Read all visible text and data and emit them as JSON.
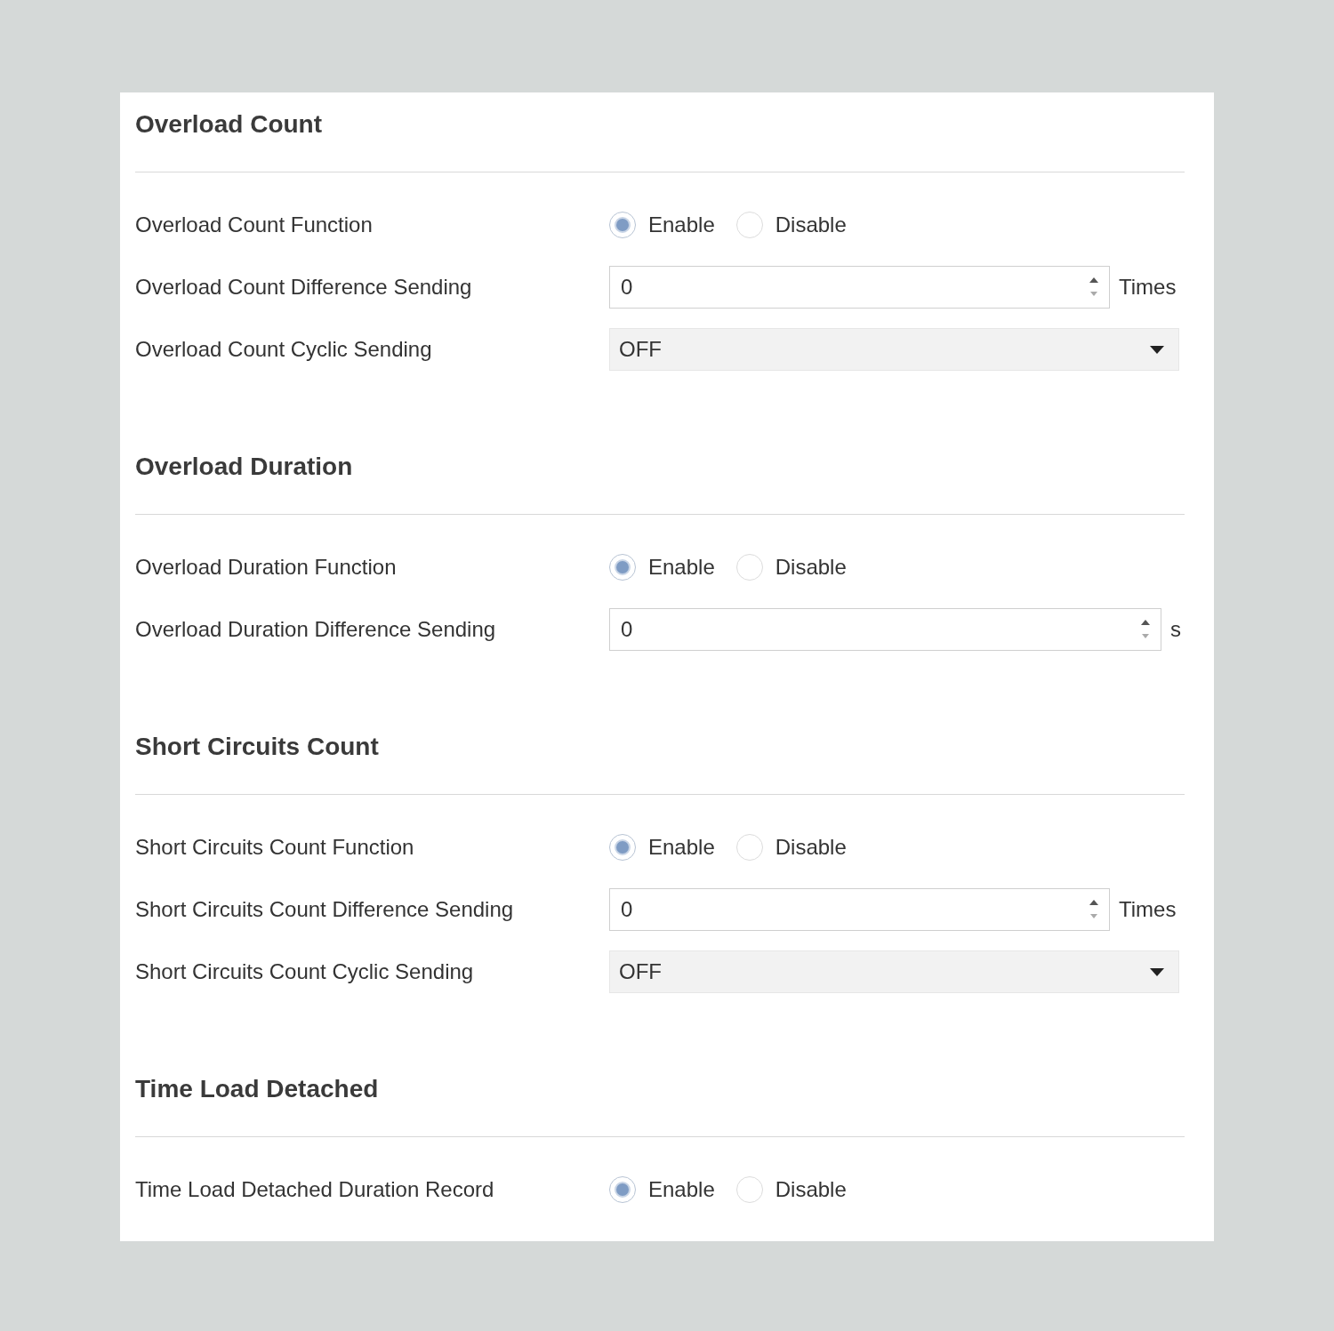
{
  "sections": [
    {
      "title": "Overload Count",
      "rows": [
        {
          "kind": "radio",
          "label": "Overload Count Function",
          "options": [
            {
              "label": "Enable",
              "selected": true
            },
            {
              "label": "Disable",
              "selected": false
            }
          ]
        },
        {
          "kind": "spin",
          "label": "Overload Count Difference Sending",
          "value": "0",
          "unit": "Times"
        },
        {
          "kind": "select",
          "label": "Overload Count Cyclic Sending",
          "value": "OFF"
        }
      ]
    },
    {
      "title": "Overload Duration",
      "rows": [
        {
          "kind": "radio",
          "label": "Overload Duration Function",
          "options": [
            {
              "label": "Enable",
              "selected": true
            },
            {
              "label": "Disable",
              "selected": false
            }
          ]
        },
        {
          "kind": "spin",
          "label": "Overload Duration Difference Sending",
          "value": "0",
          "unit": "s"
        }
      ]
    },
    {
      "title": "Short Circuits Count",
      "rows": [
        {
          "kind": "radio",
          "label": "Short Circuits Count Function",
          "options": [
            {
              "label": "Enable",
              "selected": true
            },
            {
              "label": "Disable",
              "selected": false
            }
          ]
        },
        {
          "kind": "spin",
          "label": "Short Circuits Count Difference Sending",
          "value": "0",
          "unit": "Times"
        },
        {
          "kind": "select",
          "label": "Short Circuits Count Cyclic Sending",
          "value": "OFF"
        }
      ]
    },
    {
      "title": "Time Load Detached",
      "rows": [
        {
          "kind": "radio",
          "label": "Time Load Detached Duration Record",
          "options": [
            {
              "label": "Enable",
              "selected": true
            },
            {
              "label": "Disable",
              "selected": false
            }
          ]
        }
      ]
    }
  ]
}
